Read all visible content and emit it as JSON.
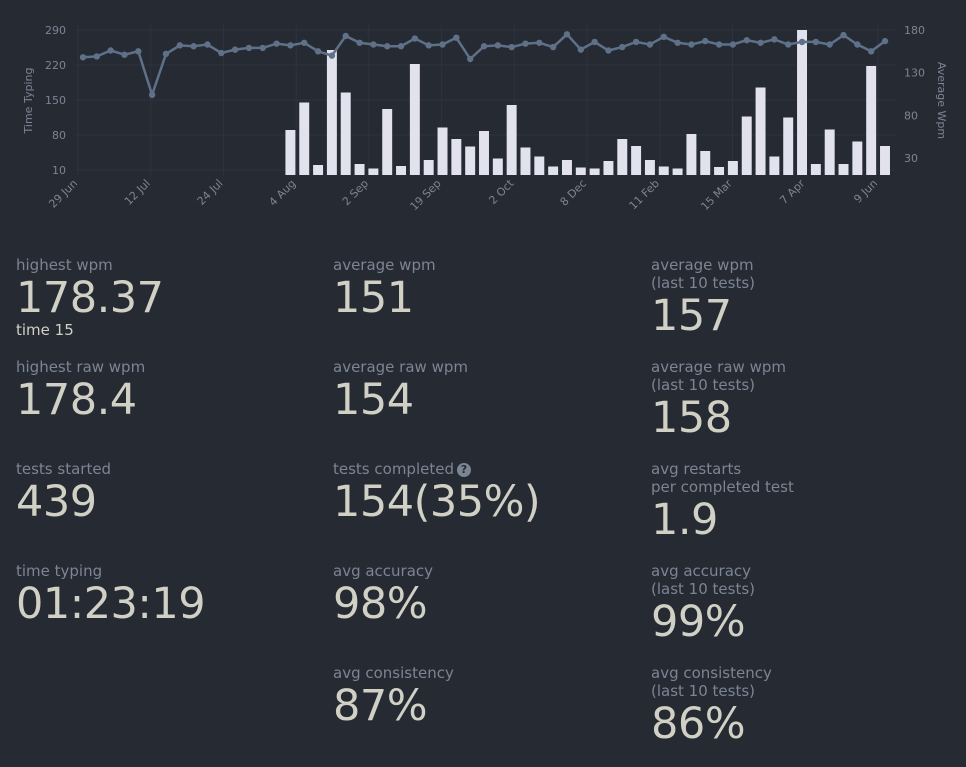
{
  "chart_data": {
    "type": "bar+line",
    "left_axis": {
      "label": "Time Typing",
      "ticks": [
        10,
        80,
        150,
        220,
        290
      ],
      "range": [
        0,
        290
      ]
    },
    "right_axis": {
      "label": "Average Wpm",
      "ticks": [
        30,
        80,
        130,
        180
      ],
      "range": [
        10,
        180
      ]
    },
    "x_tick_labels": [
      "29 Jun",
      "12 Jul",
      "24 Jul",
      "4 Aug",
      "2 Sep",
      "19 Sep",
      "2 Oct",
      "8 Dec",
      "11 Feb",
      "15 Mar",
      "7 Apr",
      "9 Jun"
    ],
    "grid": true,
    "bar_color": "#e2e2ee",
    "line_color": "#5e7189",
    "series": [
      {
        "axis": "left",
        "render": "bar",
        "values": [
          0,
          0,
          0,
          0,
          0,
          0,
          0,
          0,
          0,
          0,
          0,
          0,
          0,
          0,
          0,
          90,
          145,
          20,
          250,
          165,
          22,
          13,
          132,
          18,
          222,
          30,
          95,
          72,
          57,
          88,
          33,
          140,
          55,
          37,
          17,
          30,
          15,
          13,
          28,
          72,
          58,
          30,
          17,
          13,
          82,
          48,
          16,
          28,
          117,
          175,
          37,
          115,
          290,
          22,
          91,
          22,
          67,
          218,
          58
        ]
      },
      {
        "axis": "right",
        "render": "line",
        "values": [
          148,
          149,
          156,
          151,
          155,
          104,
          152,
          162,
          161,
          163,
          153,
          157,
          159,
          159,
          164,
          162,
          165,
          155,
          150,
          173,
          165,
          163,
          161,
          161,
          170,
          162,
          163,
          171,
          146,
          161,
          162,
          160,
          164,
          165,
          160,
          175,
          157,
          166,
          156,
          160,
          166,
          163,
          172,
          165,
          163,
          167,
          163,
          163,
          168,
          165,
          169,
          163,
          166,
          166,
          163,
          174,
          163,
          155,
          167
        ]
      }
    ]
  },
  "stats": {
    "highest_wpm": {
      "label": "highest wpm",
      "value": "178.37",
      "extra": "time 15"
    },
    "highest_raw_wpm": {
      "label": "highest raw wpm",
      "value": "178.4"
    },
    "tests_started": {
      "label": "tests started",
      "value": "439"
    },
    "time_typing": {
      "label": "time typing",
      "value": "01:23:19"
    },
    "average_wpm": {
      "label": "average wpm",
      "value": "151"
    },
    "average_raw_wpm": {
      "label": "average raw wpm",
      "value": "154"
    },
    "tests_completed": {
      "label": "tests completed",
      "value": "154(35%)",
      "icon": "question-circle-icon"
    },
    "avg_accuracy": {
      "label": "avg accuracy",
      "value": "98%"
    },
    "avg_consistency": {
      "label": "avg consistency",
      "value": "87%"
    },
    "average_wpm_last10": {
      "label": "average wpm",
      "sub": "(last 10 tests)",
      "value": "157"
    },
    "average_raw_wpm_last10": {
      "label": "average raw wpm",
      "sub": "(last 10 tests)",
      "value": "158"
    },
    "avg_restarts": {
      "label": "avg restarts",
      "sub": "per completed test",
      "value": "1.9"
    },
    "avg_accuracy_last10": {
      "label": "avg accuracy",
      "sub": "(last 10 tests)",
      "value": "99%"
    },
    "avg_consistency_last10": {
      "label": "avg consistency",
      "sub": "(last 10 tests)",
      "value": "86%"
    }
  }
}
